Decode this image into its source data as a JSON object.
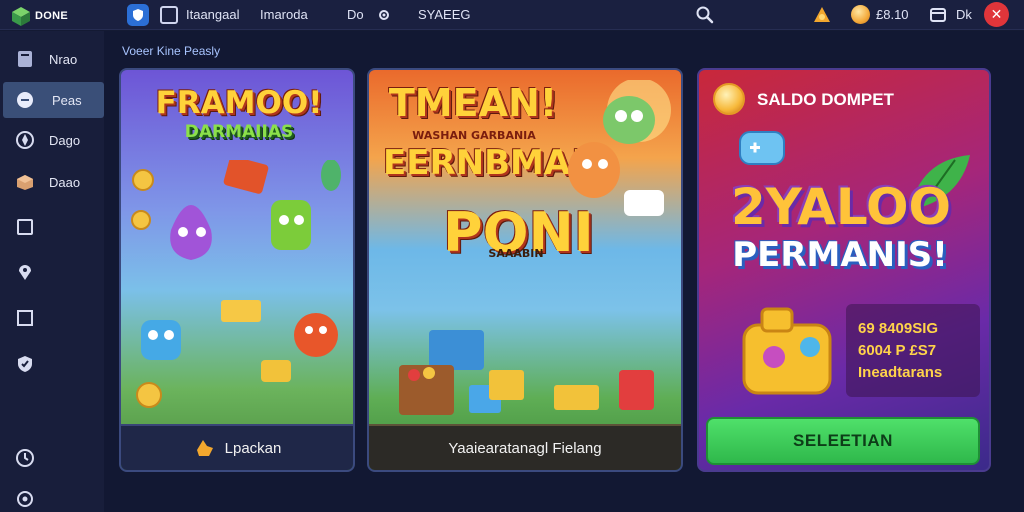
{
  "app": {
    "logo_text": "DONE"
  },
  "topbar": {
    "items": [
      "Itaangaal",
      "Imaroda",
      "Do",
      "SYAEEG"
    ],
    "balance": "£8.10",
    "user": "Dk"
  },
  "sidebar": {
    "items": [
      {
        "label": "Nrao",
        "icon": "book-icon"
      },
      {
        "label": "Peas",
        "icon": "gamepad-icon",
        "active": true
      },
      {
        "label": "Dago",
        "icon": "compass-icon"
      },
      {
        "label": "Daao",
        "icon": "box-icon"
      },
      {
        "label": "",
        "icon": "square-icon"
      },
      {
        "label": "",
        "icon": "pin-icon"
      },
      {
        "label": "",
        "icon": "window-icon"
      },
      {
        "label": "",
        "icon": "shield-icon"
      },
      {
        "label": "",
        "icon": "clock-icon"
      },
      {
        "label": "",
        "icon": "settings-icon"
      }
    ]
  },
  "breadcrumb": "Voeer Kine Peasly",
  "cards": [
    {
      "title_line1": "FRAMOO!",
      "title_line2": "DARMAIIAS",
      "footer": "Lpackan"
    },
    {
      "title_line1": "TMEAN!",
      "title_line2": "WASHAN GARBANIA",
      "title_line3": "EERNBMA!",
      "title_line4": "PONI",
      "title_line5": "SAAABIN",
      "footer": "Yaaiearatanagl Fielang"
    },
    {
      "header": "SALDO DOMPET",
      "title_line1": "2YALOO",
      "title_line2": "PERMANIS!",
      "info": [
        "69 8409SIG",
        "6004 P £S7",
        "Ineadtarans"
      ],
      "button": "SELEETIAN"
    }
  ],
  "colors": {
    "accent": "#2fb84b",
    "active_sidebar": "#3a4f78",
    "background": "#141a33"
  }
}
